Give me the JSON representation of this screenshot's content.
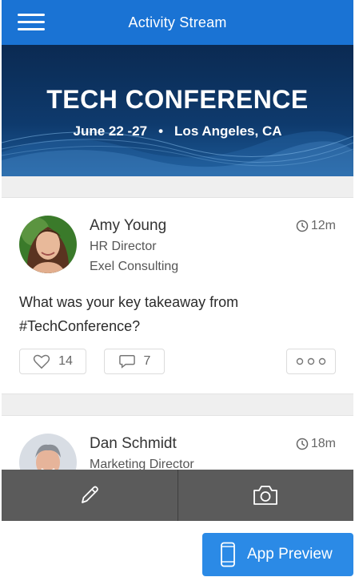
{
  "header": {
    "title": "Activity Stream"
  },
  "banner": {
    "title": "TECH CONFERENCE",
    "dates": "June 22 -27",
    "separator": "•",
    "location": "Los Angeles, CA"
  },
  "posts": [
    {
      "name": "Amy Young",
      "role": "HR Director",
      "company": "Exel Consulting",
      "time": "12m",
      "text": "What was your key takeaway from #TechConference?",
      "likes": "14",
      "comments": "7"
    },
    {
      "name": "Dan Schmidt",
      "role": "Marketing Director",
      "time": "18m"
    }
  ],
  "app_preview": {
    "label": "App Preview"
  },
  "colors": {
    "topbar": "#1a73d4",
    "action_bar": "#5b5b5b",
    "app_preview": "#2b8ae6"
  }
}
